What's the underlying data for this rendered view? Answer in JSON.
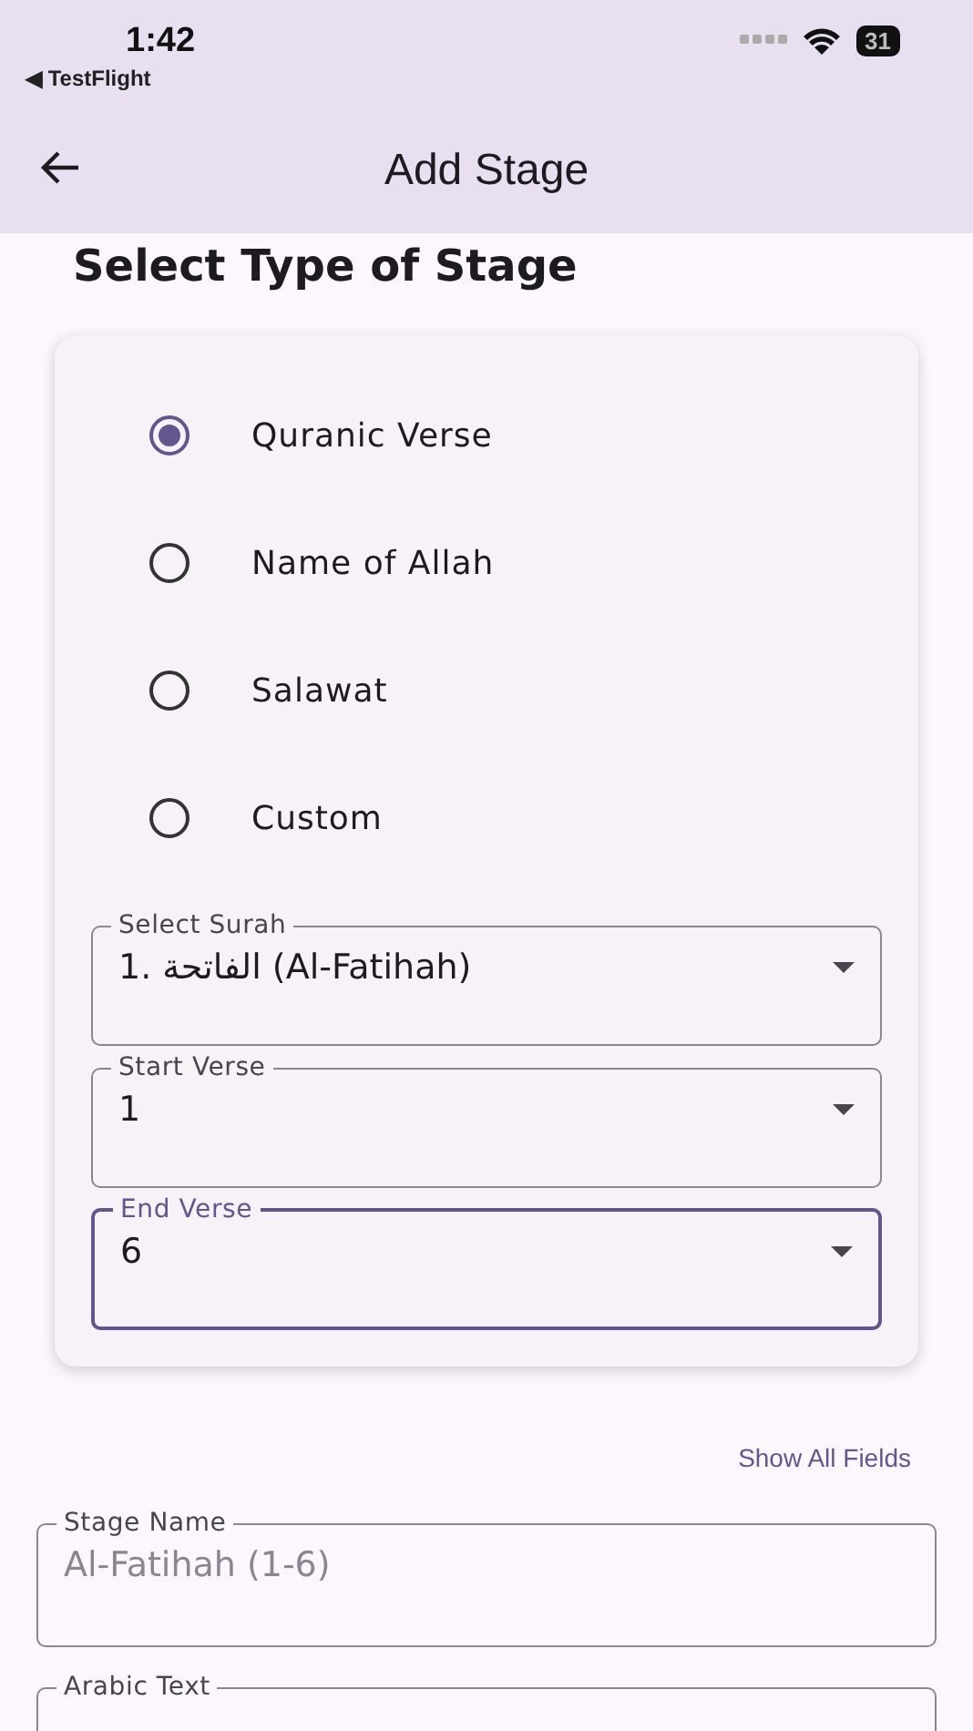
{
  "status_bar": {
    "time": "1:42",
    "back_app": "◀ TestFlight",
    "battery": "31"
  },
  "app_bar": {
    "title": "Add Stage"
  },
  "section_title": "Select Type of Stage",
  "stage_types": [
    {
      "label": "Quranic Verse",
      "selected": true
    },
    {
      "label": "Name of Allah",
      "selected": false
    },
    {
      "label": "Salawat",
      "selected": false
    },
    {
      "label": "Custom",
      "selected": false
    }
  ],
  "verse_fields": [
    {
      "label": "Select Surah",
      "value": "1. الفاتحة (Al-Fatihah)",
      "focused": false
    },
    {
      "label": "Start Verse",
      "value": "1",
      "focused": false
    },
    {
      "label": "End Verse",
      "value": "6",
      "focused": true
    }
  ],
  "show_all_fields": "Show All Fields",
  "form_fields": [
    {
      "label": "Stage Name",
      "placeholder": "Al-Fatihah (1-6)"
    },
    {
      "label": "Arabic Text"
    }
  ]
}
